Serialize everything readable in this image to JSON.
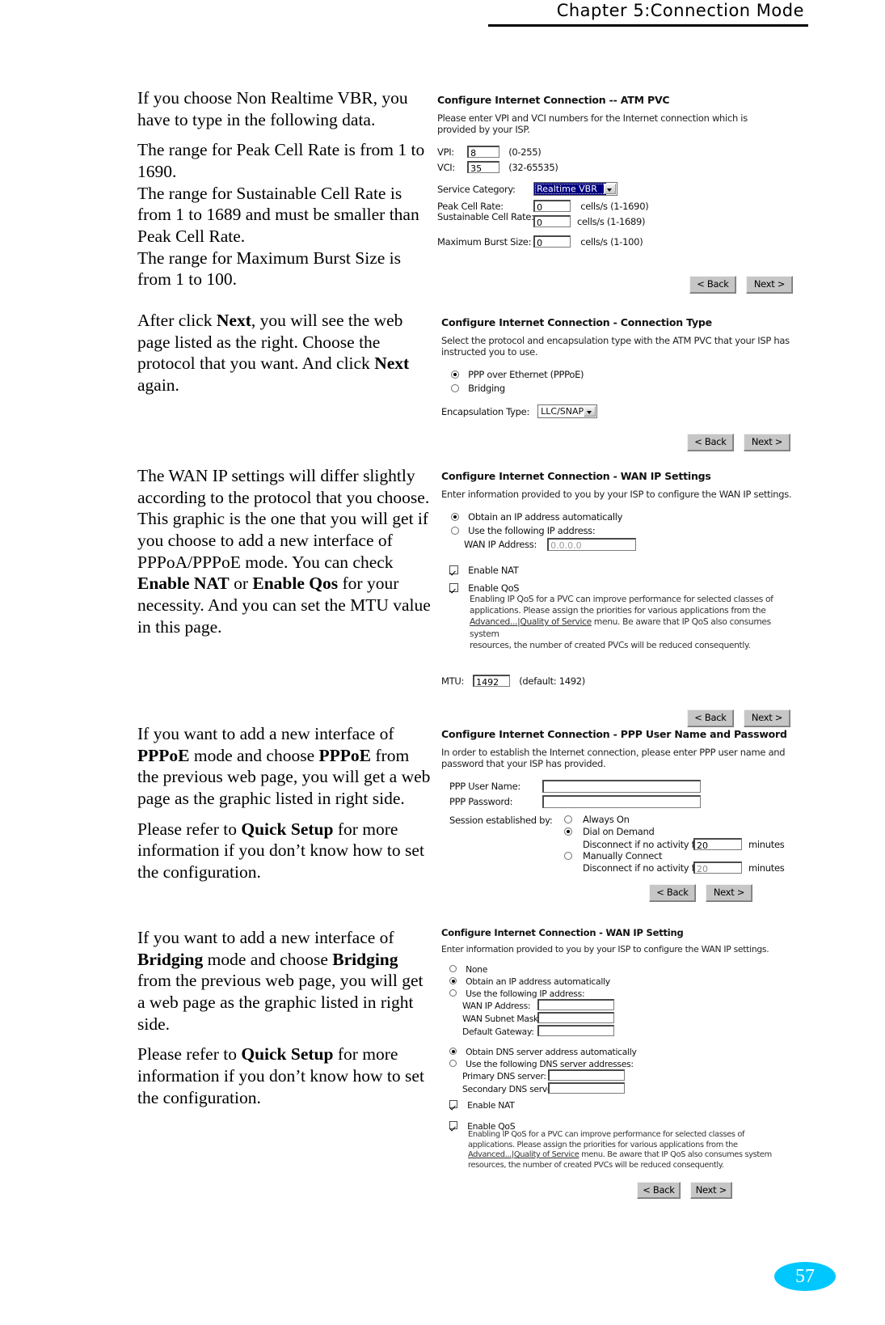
{
  "header": {
    "chapter_title": "Chapter 5:Connection Mode"
  },
  "footer": {
    "page_number": "57"
  },
  "colors": {
    "page_badge": "#00c8ff",
    "select_highlight": "#000080",
    "button_face": "#c6c6c6"
  },
  "sections": [
    {
      "id": "atm-pvc",
      "body": {
        "p1": "If you choose Non Realtime VBR, you have to type in the following data.",
        "p2_line1": "The range for Peak Cell Rate is from 1 to 1690.",
        "p2_line2": "The range for Sustainable Cell Rate is from 1 to 1689 and must be smaller than Peak Cell Rate.",
        "p2_line3": "The range for Maximum Burst Size is from 1 to 100."
      },
      "screenshot": {
        "title": "Configure Internet Connection -- ATM PVC",
        "description": "Please enter VPI and VCI numbers for the Internet connection which is provided by your ISP.",
        "fields": {
          "vpi_label": "VPI:",
          "vpi_value": "8",
          "vpi_range": "(0-255)",
          "vci_label": "VCI:",
          "vci_value": "35",
          "vci_range": "(32-65535)",
          "service_category_label": "Service Category:",
          "service_category_value": "Realtime VBR",
          "peak_cell_rate_label": "Peak Cell Rate:",
          "peak_cell_rate_value": "0",
          "peak_cell_rate_units": "cells/s (1-1690)",
          "sustainable_cell_rate_label": "Sustainable Cell Rate:",
          "sustainable_cell_rate_value": "0",
          "sustainable_cell_rate_units": "cells/s (1-1689)",
          "max_burst_size_label": "Maximum Burst Size:",
          "max_burst_size_value": "0",
          "max_burst_size_units": "cells/s (1-100)"
        },
        "buttons": {
          "back": "< Back",
          "next": "Next >"
        }
      }
    },
    {
      "id": "connection-type",
      "body": {
        "p1_a": "After click ",
        "p1_b": "Next",
        "p1_c": ", you will see the web page listed as the right. Choose the protocol that you want. And click ",
        "p1_d": "Next",
        "p1_e": " again."
      },
      "screenshot": {
        "title": "Configure Internet Connection - Connection Type",
        "description": "Select the protocol and encapsulation type with the ATM PVC that your ISP has instructed you to use.",
        "options": [
          {
            "label": "PPP over Ethernet (PPPoE)",
            "selected": true
          },
          {
            "label": "Bridging",
            "selected": false
          }
        ],
        "encapsulation_label": "Encapsulation Type:",
        "encapsulation_value": "LLC/SNAP",
        "buttons": {
          "back": "< Back",
          "next": "Next >"
        }
      }
    },
    {
      "id": "wan-ip-settings",
      "body": {
        "p1_a": "The WAN IP settings will differ slightly according to the protocol that you choose. This graphic is the one that you will get if you choose to add a new interface of PPPoA/PPPoE mode. You can check ",
        "p1_b": "Enable NAT",
        "p1_c": " or ",
        "p1_d": "Enable Qos",
        "p1_e": " for your necessity. And you can set the MTU value in this page."
      },
      "screenshot": {
        "title": "Configure Internet Connection - WAN IP Settings",
        "description": "Enter information provided to you by your ISP to configure the WAN IP settings.",
        "options": [
          {
            "label": "Obtain an IP address automatically",
            "selected": true
          },
          {
            "label": "Use the following IP address:",
            "selected": false
          }
        ],
        "wan_ip_label": "WAN IP Address:",
        "wan_ip_value": "0.0.0.0",
        "enable_nat_label": "Enable NAT",
        "enable_nat_checked": true,
        "enable_qos_label": "Enable QoS",
        "enable_qos_checked": true,
        "qos_note_1": "Enabling IP QoS for a PVC can improve performance for selected classes of",
        "qos_note_2": "applications. Please assign the priorities for various applications from the",
        "qos_note_3_link": "Advanced...|Quality of Service",
        "qos_note_3_rest": " menu. Be aware that IP QoS also consumes system",
        "qos_note_4": "resources, the number of created PVCs will be reduced consequently.",
        "mtu_label": "MTU:",
        "mtu_value": "1492",
        "mtu_default": "(default: 1492)",
        "buttons": {
          "back": "< Back",
          "next": "Next >"
        }
      }
    },
    {
      "id": "ppp-username-password",
      "body": {
        "p1_a": "If you want to add a new interface of ",
        "p1_b": "PPPoE",
        "p1_c": " mode and choose ",
        "p1_d": "PPPoE",
        "p1_e": " from the previous web page, you will get a web page as the graphic listed in right side.",
        "p2_a": "Please refer to ",
        "p2_b": "Quick Setup",
        "p2_c": " for more information if you don’t know how to set the configuration."
      },
      "screenshot": {
        "title": "Configure Internet Connection - PPP User Name and Password",
        "description": "In order to establish the Internet connection, please enter PPP user name and password that your ISP has provided.",
        "user_name_label": "PPP User Name:",
        "user_name_value": "",
        "password_label": "PPP Password:",
        "password_value": "",
        "session_label": "Session established by:",
        "session_options": [
          {
            "label": "Always On",
            "selected": false
          },
          {
            "label": "Dial on Demand",
            "selected": true
          },
          {
            "label": "Manually Connect",
            "selected": false
          }
        ],
        "disconnect_label": "Disconnect if no activity for",
        "disconnect_value_1": "20",
        "disconnect_value_2": "20",
        "minutes_label": "minutes",
        "buttons": {
          "back": "< Back",
          "next": "Next >"
        }
      }
    },
    {
      "id": "bridging-wan-ip",
      "body": {
        "p1_a": "If you want to add a new interface of ",
        "p1_b": "Bridging",
        "p1_c": " mode and choose ",
        "p1_d": "Bridging",
        "p1_e": " from the previous web page, you will get a web page as the graphic listed in right side.",
        "p2_a": "Please refer to ",
        "p2_b": "Quick Setup",
        "p2_c": " for more information if you don’t know how to set the configuration."
      },
      "screenshot": {
        "title": "Configure Internet Connection - WAN IP Setting",
        "description": "Enter information provided to you by your ISP to configure the WAN IP settings.",
        "ip_options": [
          {
            "label": "None",
            "selected": false
          },
          {
            "label": "Obtain an IP address automatically",
            "selected": true
          },
          {
            "label": "Use the following IP address:",
            "selected": false
          }
        ],
        "wan_ip_label": "WAN IP Address:",
        "wan_subnet_label": "WAN Subnet Mask:",
        "default_gateway_label": "Default Gateway:",
        "dns_options": [
          {
            "label": "Obtain DNS server address automatically",
            "selected": true
          },
          {
            "label": "Use the following DNS server addresses:",
            "selected": false
          }
        ],
        "primary_dns_label": "Primary DNS server:",
        "secondary_dns_label": "Secondary DNS server:",
        "enable_nat_label": "Enable NAT",
        "enable_nat_checked": true,
        "enable_qos_label": "Enable QoS",
        "enable_qos_checked": true,
        "qos_note_1": "Enabling IP QoS for a PVC can improve performance for selected classes of",
        "qos_note_2": "applications. Please assign the priorities for various applications from the",
        "qos_note_3_link": "Advanced...|Quality of Service",
        "qos_note_3_rest": " menu. Be aware that IP QoS also consumes system",
        "qos_note_4": "resources, the number of created PVCs will be reduced consequently.",
        "buttons": {
          "back": "< Back",
          "next": "Next >"
        }
      }
    }
  ]
}
